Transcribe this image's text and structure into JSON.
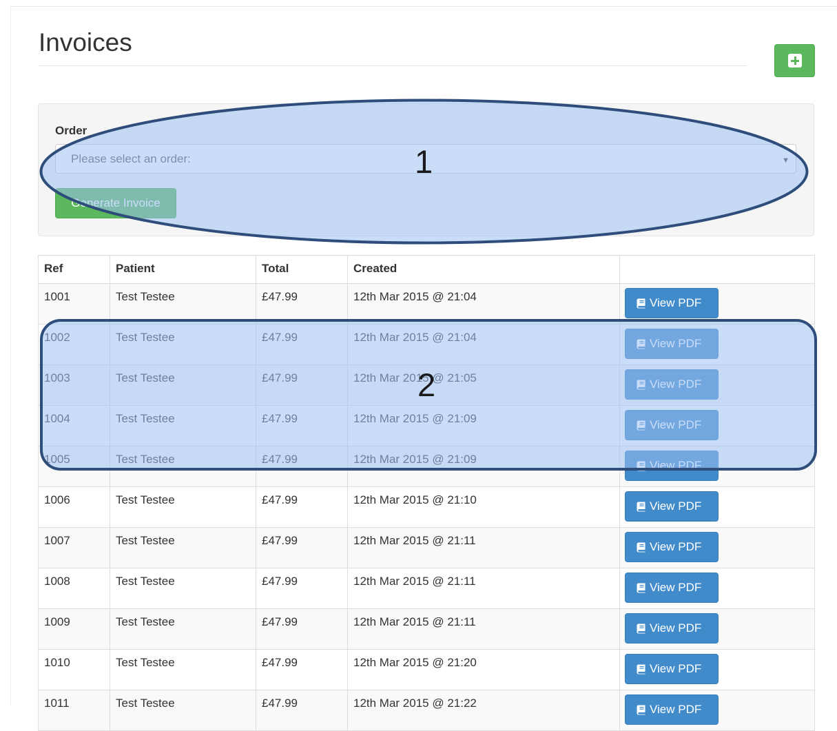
{
  "page": {
    "title": "Invoices"
  },
  "icons": {
    "add": "plus-square-icon",
    "pdf": "book-icon",
    "caret": "caret-down-icon"
  },
  "colors": {
    "success": "#5cb85c",
    "primary": "#428bca",
    "annotation_fill": "#9cc0f2",
    "annotation_border": "#2e4d7a"
  },
  "form": {
    "order_label": "Order",
    "order_select": {
      "placeholder": "Please select an order:"
    },
    "generate_label": "Generate Invoice"
  },
  "table": {
    "columns": [
      "Ref",
      "Patient",
      "Total",
      "Created",
      ""
    ],
    "button_label": "View PDF",
    "rows": [
      {
        "ref": "1001",
        "patient": "Test Testee",
        "total": "£47.99",
        "created": "12th Mar 2015 @ 21:04"
      },
      {
        "ref": "1002",
        "patient": "Test Testee",
        "total": "£47.99",
        "created": "12th Mar 2015 @ 21:04"
      },
      {
        "ref": "1003",
        "patient": "Test Testee",
        "total": "£47.99",
        "created": "12th Mar 2015 @ 21:05"
      },
      {
        "ref": "1004",
        "patient": "Test Testee",
        "total": "£47.99",
        "created": "12th Mar 2015 @ 21:09"
      },
      {
        "ref": "1005",
        "patient": "Test Testee",
        "total": "£47.99",
        "created": "12th Mar 2015 @ 21:09"
      },
      {
        "ref": "1006",
        "patient": "Test Testee",
        "total": "£47.99",
        "created": "12th Mar 2015 @ 21:10"
      },
      {
        "ref": "1007",
        "patient": "Test Testee",
        "total": "£47.99",
        "created": "12th Mar 2015 @ 21:11"
      },
      {
        "ref": "1008",
        "patient": "Test Testee",
        "total": "£47.99",
        "created": "12th Mar 2015 @ 21:11"
      },
      {
        "ref": "1009",
        "patient": "Test Testee",
        "total": "£47.99",
        "created": "12th Mar 2015 @ 21:11"
      },
      {
        "ref": "1010",
        "patient": "Test Testee",
        "total": "£47.99",
        "created": "12th Mar 2015 @ 21:20"
      },
      {
        "ref": "1011",
        "patient": "Test Testee",
        "total": "£47.99",
        "created": "12th Mar 2015 @ 21:22"
      }
    ]
  },
  "annotations": {
    "label_1": "1",
    "label_2": "2"
  }
}
